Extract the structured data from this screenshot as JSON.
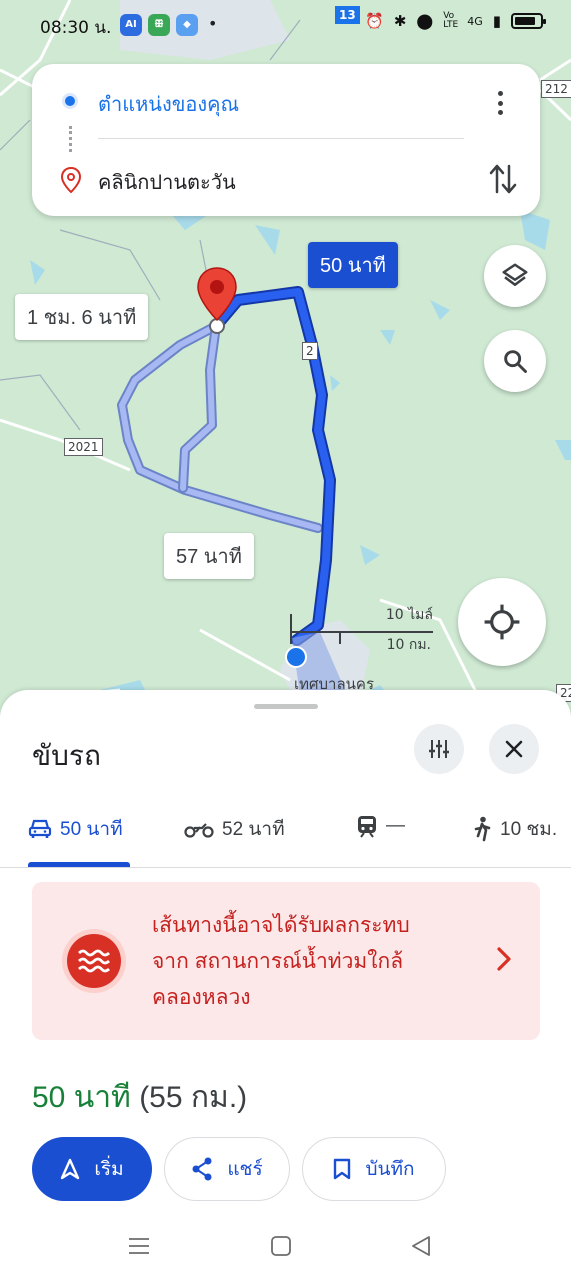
{
  "status_bar": {
    "time": "08:30 น.",
    "network": "4G",
    "volte": "Vo LTE",
    "badge_ai": "AI"
  },
  "route_card": {
    "origin": "ตำแหน่งของคุณ",
    "destination": "คลินิกปานตะวัน"
  },
  "map": {
    "primary_route_time": "50 นาที",
    "alt_route_1_time": "1 ชม. 6 นาที",
    "alt_route_2_time": "57 นาที",
    "road_2": "2",
    "road_2021": "2021",
    "road_13": "13",
    "road_212": "212",
    "road_22": "22",
    "scale_miles": "10 ไมล์",
    "scale_km": "10 กม.",
    "city_label": "เทศบาลนคร",
    "colors": {
      "route_primary": "#1a4fd1",
      "route_alt": "#a7b8f2",
      "map_bg": "#cfe9d3",
      "water": "#a8dbea"
    }
  },
  "sheet": {
    "title": "ขับรถ",
    "modes": [
      {
        "icon": "car-icon",
        "label": "50 นาที",
        "active": true
      },
      {
        "icon": "motorcycle-icon",
        "label": "52 นาที",
        "active": false
      },
      {
        "icon": "train-icon",
        "label": "—",
        "active": false
      },
      {
        "icon": "walk-icon",
        "label": "10 ชม.",
        "active": false
      }
    ],
    "alert": {
      "line1": "เส้นทางนี้อาจได้รับผลกระทบ",
      "line2": "จาก สถานการณ์น้ำท่วมใกล้",
      "line3": "คลองหลวง"
    },
    "summary_duration": "50 นาที",
    "summary_distance": "(55 กม.)",
    "actions": {
      "start": "เริ่ม",
      "share": "แชร์",
      "save": "บันทึก"
    }
  }
}
